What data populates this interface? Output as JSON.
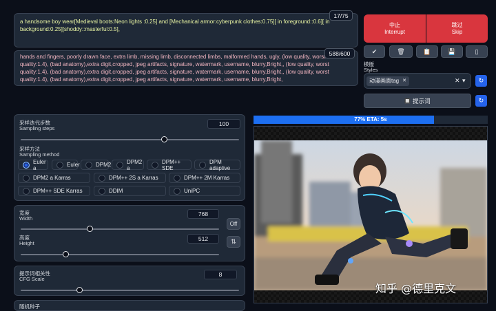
{
  "prompt": {
    "positive": "a handsome boy wear[Medieval boots:Neon lights :0.25] and [Mechanical armor:cyberpunk clothes:0.75][ in foreground::0.6][ in background:0.25][shoddy::masterful:0.5],",
    "positive_count": "17/75",
    "negative": "hands and fingers, poorly drawn face, extra limb, missing limb, disconnected limbs, malformed hands, ugly, (low quality, worst quality:1.4), (bad anatomy),extra digit,cropped, jpeg artifacts, signature, watermark, username, blurry,Bright,, (low quality, worst quality:1.4), (bad anatomy),extra digit,cropped, jpeg artifacts, signature, watermark, username, blurry,Bright,, (low quality, worst quality:1.4), (bad anatomy),extra digit,cropped, jpeg artifacts, signature, watermark, username, blurry,Bright,",
    "negative_count": "588/600"
  },
  "generate": {
    "interrupt_zh": "中止",
    "interrupt_en": "Interrupt",
    "skip_zh": "跳过",
    "skip_en": "Skip"
  },
  "tools": [
    {
      "icon": "check-icon",
      "glyph": "✔"
    },
    {
      "icon": "trash-icon",
      "glyph": "🗑"
    },
    {
      "icon": "clipboard-icon",
      "glyph": "📋"
    },
    {
      "icon": "save-icon",
      "glyph": "💾"
    },
    {
      "icon": "phone-icon",
      "glyph": "▯"
    }
  ],
  "styles": {
    "label_zh": "模版",
    "label_en": "Styles",
    "selected_tag": "动漫画面tag",
    "clear_icon": "✕",
    "dropdown_icon": "▾",
    "refresh_icon": "↻"
  },
  "prompt_button": {
    "icon": "🔲",
    "label": "提示词"
  },
  "sampling_steps": {
    "label_zh": "采样迭代步数",
    "label_en": "Sampling steps",
    "value": "100",
    "fraction": 0.66
  },
  "sampling_method": {
    "label_zh": "采样方法",
    "label_en": "Sampling method",
    "options": [
      "Euler a",
      "Euler",
      "DPM2",
      "DPM2 a",
      "DPM++ SDE",
      "DPM adaptive",
      "DPM2 a Karras",
      "DPM++ 2S a Karras",
      "DPM++ 2M Karras",
      "DPM++ SDE Karras",
      "DDIM",
      "UniPC"
    ],
    "selected": "Euler a"
  },
  "width": {
    "label_zh": "宽度",
    "label_en": "Width",
    "value": "768",
    "fraction": 0.35
  },
  "height": {
    "label_zh": "高度",
    "label_en": "Height",
    "value": "512",
    "fraction": 0.23
  },
  "toggles": {
    "off_label": "Off",
    "swap_icon": "⇅"
  },
  "cfg": {
    "label_zh": "提示词相关性",
    "label_en": "CFG Scale",
    "value": "8",
    "fraction": 0.27
  },
  "next_section_label": "随机种子",
  "progress": {
    "text": "77% ETA: 5s",
    "fraction": 0.77,
    "color": "#1d6ff2"
  },
  "watermark": "知乎 @德里克文",
  "colors": {
    "accent_red": "#d9363e",
    "accent_blue": "#2563eb",
    "positive_text": "#e9f5a3",
    "negative_text": "#f1b5c0",
    "page_bg": "#0b0f19"
  }
}
